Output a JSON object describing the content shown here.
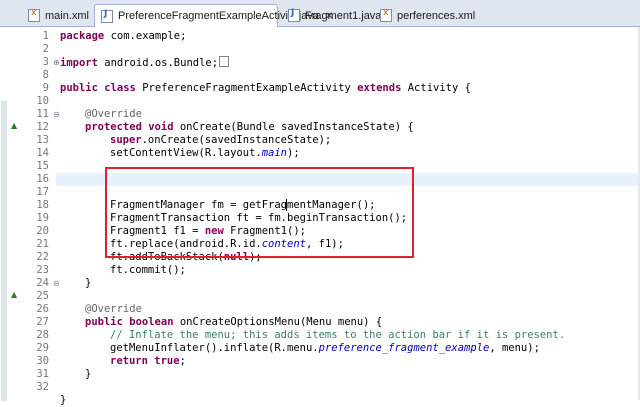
{
  "tabs": [
    {
      "label": "main.xml",
      "icon": "xml-file-icon",
      "active": false
    },
    {
      "label": "PreferenceFragmentExampleActivity.java",
      "icon": "java-file-icon",
      "active": true,
      "close": "✕"
    },
    {
      "label": "Fragment1.java",
      "icon": "java-file-icon",
      "active": false
    },
    {
      "label": "perferences.xml",
      "icon": "xml-file-icon",
      "active": false
    }
  ],
  "line_numbers": [
    "1",
    "2",
    "3",
    "8",
    "9",
    "10",
    "11",
    "12",
    "13",
    "14",
    "15",
    "16",
    "17",
    "18",
    "19",
    "20",
    "21",
    "22",
    "23",
    "24",
    "25",
    "26",
    "27",
    "28",
    "29",
    "30",
    "31",
    "32"
  ],
  "code": {
    "l1": {
      "kw": "package",
      "rest": " com.example;"
    },
    "l3": {
      "kw": "import",
      "rest": " android.os.Bundle;"
    },
    "l9": {
      "kw1": "public",
      "kw2": "class",
      "mid": " PreferenceFragmentExampleActivity ",
      "kw3": "extends",
      "rest": " Activity {"
    },
    "l11": {
      "ann": "@Override"
    },
    "l12": {
      "kw1": "protected",
      "kw2": "void",
      "rest": " onCreate(Bundle savedInstanceState) {"
    },
    "l13": {
      "kw": "super",
      "rest": ".onCreate(savedInstanceState);"
    },
    "l14": {
      "pre": "setContentView(R.layout.",
      "it": "main",
      "post": ");"
    },
    "l16": {
      "text": "FragmentManager fm = getFragmentManager();"
    },
    "l17": {
      "text": "FragmentTransaction ft = fm.beginTransaction();"
    },
    "l18": {
      "pre": "Fragment1 f1 = ",
      "kw": "new",
      "post": " Fragment1();"
    },
    "l19": {
      "pre": "ft.replace(android.R.id.",
      "it": "content",
      "post": ", f1);"
    },
    "l20": {
      "pre": "ft.addToBackStack(",
      "kw": "null",
      "post": ");"
    },
    "l21": {
      "text": "ft.commit();"
    },
    "l22": {
      "text": "}"
    },
    "l24": {
      "ann": "@Override"
    },
    "l25": {
      "kw1": "public",
      "kw2": "boolean",
      "rest": " onCreateOptionsMenu(Menu menu) {"
    },
    "l26": {
      "cm": "// Inflate the menu; this adds items to the action bar if it is present."
    },
    "l27": {
      "pre": "getMenuInflater().inflate(R.menu.",
      "it": "preference_fragment_example",
      "post": ", menu);"
    },
    "l28": {
      "kw": "return",
      "mid": " ",
      "kw2": "true",
      "post": ";"
    },
    "l29": {
      "text": "}"
    },
    "l31": {
      "text": "}"
    }
  },
  "colors": {
    "keyword": "#7f0055",
    "annotation": "#646464",
    "comment": "#3f7f5f",
    "field": "#0000c0",
    "highlight_box": "#e0202a"
  }
}
